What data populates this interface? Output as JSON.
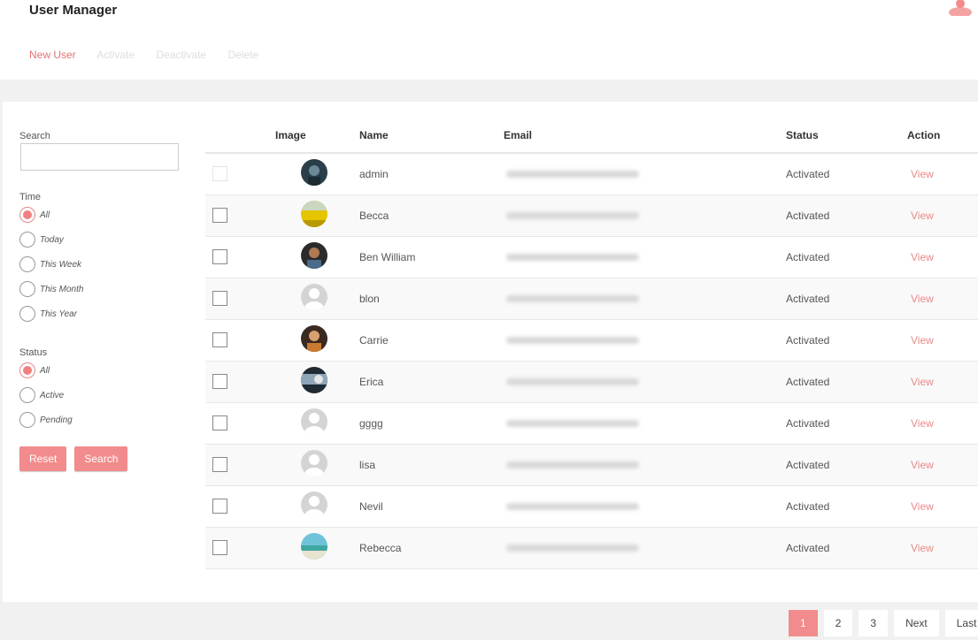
{
  "header": {
    "title": "User Manager"
  },
  "actions": {
    "new_user": "New User",
    "activate": "Activate",
    "deactivate": "Deactivate",
    "delete": "Delete"
  },
  "filters": {
    "search_label": "Search",
    "time_label": "Time",
    "time_options": [
      "All",
      "Today",
      "This Week",
      "This Month",
      "This Year"
    ],
    "time_selected": "All",
    "status_label": "Status",
    "status_options": [
      "All",
      "Active",
      "Pending"
    ],
    "status_selected": "All",
    "reset": "Reset",
    "search_button": "Search"
  },
  "table": {
    "headers": {
      "image": "Image",
      "name": "Name",
      "email": "Email",
      "status": "Status",
      "action": "Action"
    },
    "rows": [
      {
        "name": "admin",
        "status": "Activated",
        "action": "View"
      },
      {
        "name": "Becca",
        "status": "Activated",
        "action": "View"
      },
      {
        "name": "Ben William",
        "status": "Activated",
        "action": "View"
      },
      {
        "name": "blon",
        "status": "Activated",
        "action": "View"
      },
      {
        "name": "Carrie",
        "status": "Activated",
        "action": "View"
      },
      {
        "name": "Erica",
        "status": "Activated",
        "action": "View"
      },
      {
        "name": "gggg",
        "status": "Activated",
        "action": "View"
      },
      {
        "name": "lisa",
        "status": "Activated",
        "action": "View"
      },
      {
        "name": "Nevil",
        "status": "Activated",
        "action": "View"
      },
      {
        "name": "Rebecca",
        "status": "Activated",
        "action": "View"
      }
    ]
  },
  "pagination": {
    "pages": [
      "1",
      "2",
      "3"
    ],
    "next": "Next",
    "last": "Last",
    "current": "1"
  },
  "colors": {
    "accent": "#f28b8b",
    "link": "#e88a8a"
  }
}
